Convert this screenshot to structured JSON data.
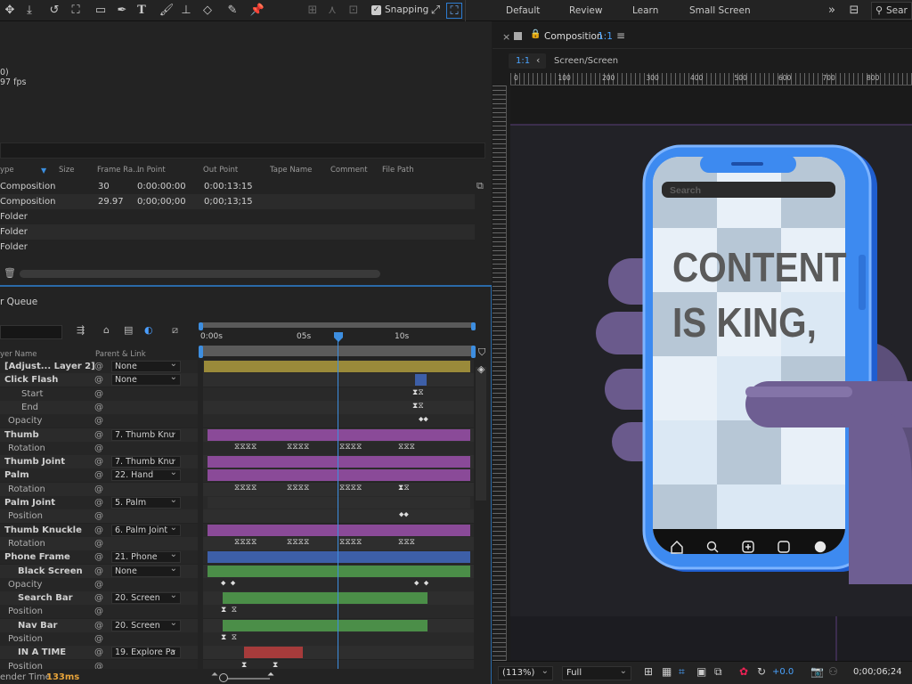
{
  "workspaces": [
    "Default",
    "Review",
    "Learn",
    "Small Screen"
  ],
  "snapping_label": "Snapping",
  "search_label": "Sear",
  "project": {
    "info_line1": "0)",
    "info_line2": "97 fps",
    "columns": [
      "ype",
      "Size",
      "Frame Ra...",
      "In Point",
      "Out Point",
      "Tape Name",
      "Comment",
      "File Path"
    ],
    "rows": [
      {
        "type": "Composition",
        "frame_rate": "30",
        "in_point": "0:00:00:00",
        "out_point": "0:00:13:15"
      },
      {
        "type": "Composition",
        "frame_rate": "29.97",
        "in_point": "0;00;00;00",
        "out_point": "0;00;13;15"
      },
      {
        "type": "Folder",
        "frame_rate": "",
        "in_point": "",
        "out_point": ""
      },
      {
        "type": "Folder",
        "frame_rate": "",
        "in_point": "",
        "out_point": ""
      },
      {
        "type": "Folder",
        "frame_rate": "",
        "in_point": "",
        "out_point": ""
      }
    ]
  },
  "timeline": {
    "queue_label": "r Queue",
    "ruler": {
      "start": "0:00s",
      "mid": "05s",
      "end": "10s"
    },
    "col_layer_name": "yer Name",
    "col_parent": "Parent & Link",
    "render_time_label": "ender Time",
    "render_time_value": "133ms",
    "layers": [
      {
        "name": "[Adjust... Layer 2]",
        "kind": "layer",
        "parent": "None"
      },
      {
        "name": "Click Flash",
        "kind": "layer",
        "parent": "None"
      },
      {
        "name": "Start",
        "kind": "prop"
      },
      {
        "name": "End",
        "kind": "prop"
      },
      {
        "name": "Opacity",
        "kind": "prop"
      },
      {
        "name": "Thumb",
        "kind": "layer",
        "parent": "7. Thumb Knu"
      },
      {
        "name": "Rotation",
        "kind": "prop"
      },
      {
        "name": "Thumb Joint",
        "kind": "layer",
        "parent": "7. Thumb Knu"
      },
      {
        "name": "Palm",
        "kind": "layer",
        "parent": "22. Hand"
      },
      {
        "name": "Rotation",
        "kind": "prop"
      },
      {
        "name": "Palm Joint",
        "kind": "layer",
        "parent": "5. Palm"
      },
      {
        "name": "Position",
        "kind": "prop"
      },
      {
        "name": "Thumb Knuckle",
        "kind": "layer",
        "parent": "6. Palm Joint"
      },
      {
        "name": "Rotation",
        "kind": "prop"
      },
      {
        "name": "Phone Frame",
        "kind": "layer",
        "parent": "21. Phone"
      },
      {
        "name": "Black Screen",
        "kind": "layer",
        "parent": "None"
      },
      {
        "name": "Opacity",
        "kind": "prop"
      },
      {
        "name": "Search Bar",
        "kind": "layer",
        "parent": "20. Screen"
      },
      {
        "name": "Position",
        "kind": "prop"
      },
      {
        "name": "Nav Bar",
        "kind": "layer",
        "parent": "20. Screen"
      },
      {
        "name": "Position",
        "kind": "prop"
      },
      {
        "name": "IN A TIME",
        "kind": "layer",
        "parent": "19. Explore Pa"
      },
      {
        "name": "Position",
        "kind": "prop"
      }
    ]
  },
  "composition": {
    "title": "Composition",
    "ratio": "1:1",
    "zoom_tab": "1:1",
    "crumb": "Screen/Screen",
    "ruler_labels": [
      "0",
      "100",
      "200",
      "300",
      "400",
      "500",
      "600",
      "700",
      "800"
    ],
    "phone_search": "Search",
    "headline_line1": "CONTENT",
    "headline_line2": "IS KING,",
    "zoom": "(113%)",
    "resolution": "Full",
    "exposure": "+0.0",
    "timecode": "0;00;06;24"
  }
}
